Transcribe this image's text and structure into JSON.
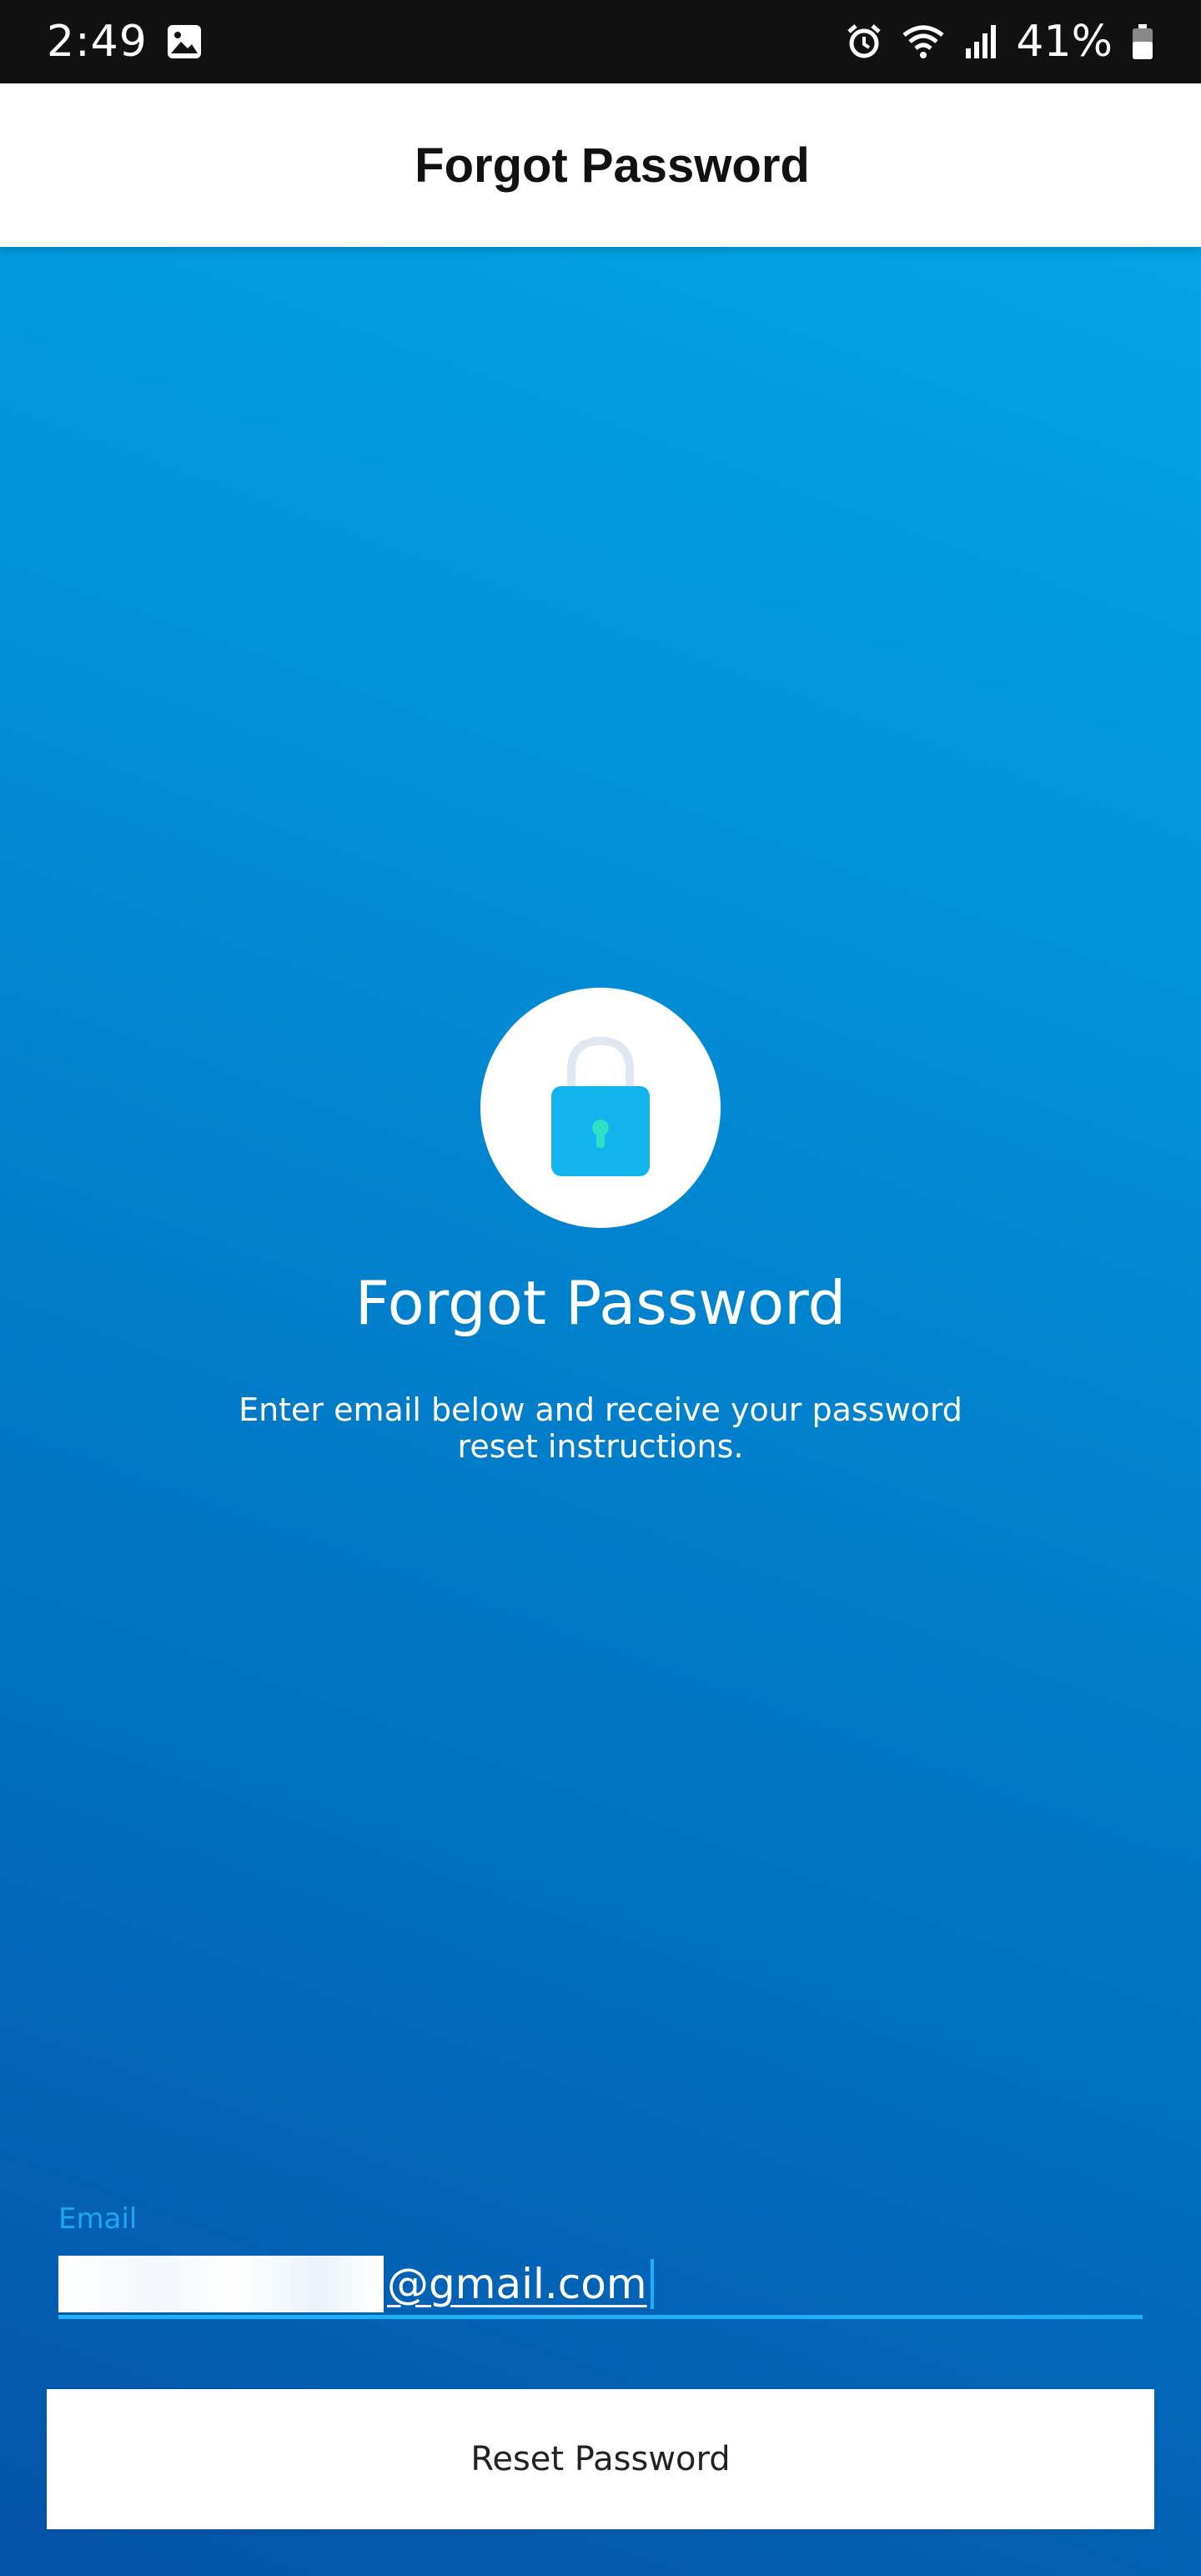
{
  "status_bar": {
    "time": "2:49",
    "battery": "41%",
    "icons": [
      "image-icon",
      "alarm-icon",
      "wifi-icon",
      "signal-icon",
      "battery-icon"
    ]
  },
  "app_bar": {
    "title": "Forgot Password"
  },
  "hero": {
    "icon": "lock-icon",
    "title": "Forgot Password",
    "subtitle": "Enter email below and receive your password reset instructions."
  },
  "form": {
    "email_label": "Email",
    "email_value": "@gmail.com",
    "submit_label": "Reset Password"
  },
  "colors": {
    "accent": "#1fb0f5",
    "background_top": "#02abea",
    "background_bottom": "#0553a8",
    "lock": "#12b4ee",
    "keyhole": "#2de0c8"
  }
}
